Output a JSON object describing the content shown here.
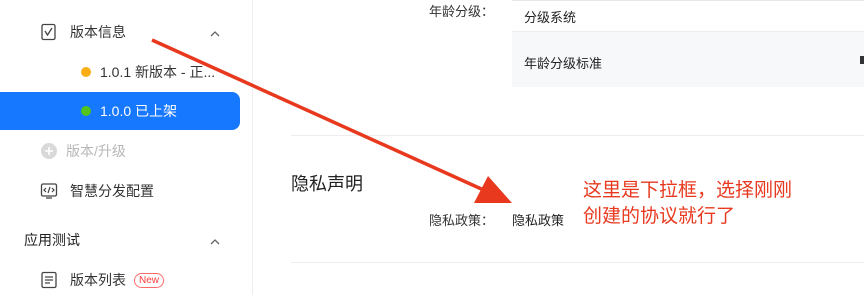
{
  "sidebar": {
    "version_info": "版本信息",
    "versions": [
      {
        "label": "1.0.1 新版本 - 正...",
        "status_color": "#faad14"
      },
      {
        "label": "1.0.0 已上架",
        "status_color": "#52c41a"
      }
    ],
    "add_version": "版本/升级",
    "smart_distribution": "智慧分发配置",
    "app_test_section": "应用测试",
    "version_list": "版本列表",
    "new_badge": "New"
  },
  "main": {
    "age_rating_label": "年龄分级：",
    "rating_system_label": "分级系统",
    "rating_standard_label": "年龄分级标准",
    "privacy_title": "隐私声明",
    "privacy_policy_label": "隐私政策：",
    "privacy_policy_value": "隐私政策"
  },
  "annotation": {
    "line1": "这里是下拉框，选择刚刚",
    "line2": "创建的协议就行了",
    "color": "#e8391f"
  },
  "colors": {
    "accent": "#1677ff"
  }
}
